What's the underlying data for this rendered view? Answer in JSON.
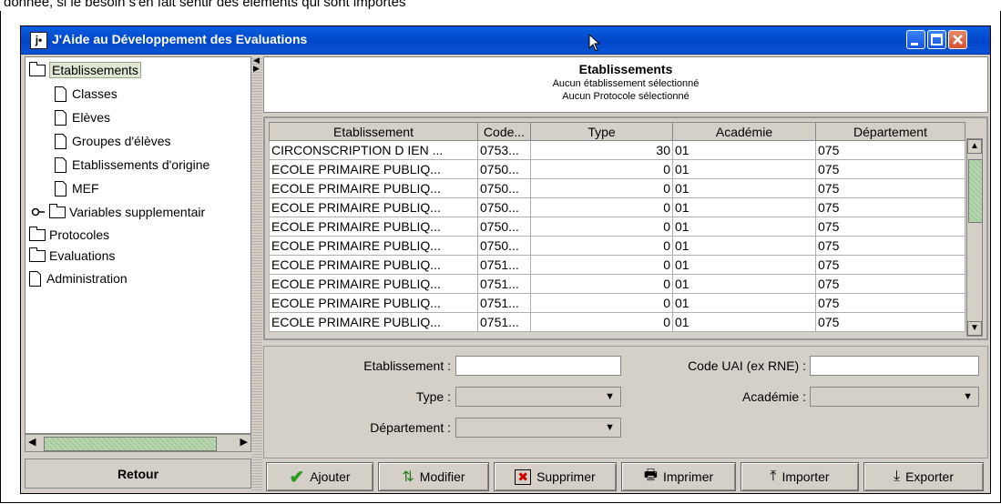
{
  "document": {
    "caption": "donnée, si le besoin s'en fait sentir des éléments qui sont importés"
  },
  "window": {
    "title": "J'Aide au Développement des Evaluations",
    "app_icon": "j•",
    "controls": [
      "minimize-icon",
      "maximize-icon",
      "close-icon"
    ]
  },
  "tree": {
    "nodes": [
      {
        "label": "Etablissements",
        "icon": "folder-icon",
        "level": 0,
        "selected": true
      },
      {
        "label": "Classes",
        "icon": "document-icon",
        "level": 1
      },
      {
        "label": "Elèves",
        "icon": "document-icon",
        "level": 1
      },
      {
        "label": "Groupes d'élèves",
        "icon": "document-icon",
        "level": 1
      },
      {
        "label": "Etablissements d'origine",
        "icon": "document-icon",
        "level": 1
      },
      {
        "label": "MEF",
        "icon": "document-icon",
        "level": 1
      },
      {
        "label": "Variables supplementair",
        "icon": "folder-icon",
        "level": 0,
        "expander": true
      },
      {
        "label": "Protocoles",
        "icon": "folder-icon",
        "level": 0
      },
      {
        "label": "Evaluations",
        "icon": "folder-icon",
        "level": 0
      },
      {
        "label": "Administration",
        "icon": "document-icon",
        "level": 0
      }
    ],
    "back_button": "Retour"
  },
  "header": {
    "title": "Etablissements",
    "line1": "Aucun établissement sélectionné",
    "line2": "Aucun Protocole sélectionné"
  },
  "table": {
    "columns": [
      "Etablissement",
      "Code...",
      "Type",
      "Académie",
      "Département"
    ],
    "rows": [
      [
        "CIRCONSCRIPTION D IEN ...",
        "0753...",
        "30",
        "01",
        "075"
      ],
      [
        "ECOLE PRIMAIRE PUBLIQ...",
        "0750...",
        "0",
        "01",
        "075"
      ],
      [
        "ECOLE PRIMAIRE PUBLIQ...",
        "0750...",
        "0",
        "01",
        "075"
      ],
      [
        "ECOLE PRIMAIRE PUBLIQ...",
        "0750...",
        "0",
        "01",
        "075"
      ],
      [
        "ECOLE PRIMAIRE PUBLIQ...",
        "0750...",
        "0",
        "01",
        "075"
      ],
      [
        "ECOLE PRIMAIRE PUBLIQ...",
        "0750...",
        "0",
        "01",
        "075"
      ],
      [
        "ECOLE PRIMAIRE PUBLIQ...",
        "0751...",
        "0",
        "01",
        "075"
      ],
      [
        "ECOLE PRIMAIRE PUBLIQ...",
        "0751...",
        "0",
        "01",
        "075"
      ],
      [
        "ECOLE PRIMAIRE PUBLIQ...",
        "0751...",
        "0",
        "01",
        "075"
      ],
      [
        "ECOLE PRIMAIRE PUBLIQ...",
        "0751...",
        "0",
        "01",
        "075"
      ]
    ]
  },
  "form": {
    "etablissement_label": "Etablissement :",
    "etablissement_value": "",
    "code_uai_label": "Code UAI (ex RNE) :",
    "code_uai_value": "",
    "type_label": "Type :",
    "type_value": "",
    "academie_label": "Académie :",
    "academie_value": "",
    "departement_label": "Département :",
    "departement_value": ""
  },
  "actions": {
    "add": "Ajouter",
    "edit": "Modifier",
    "delete": "Supprimer",
    "print": "Imprimer",
    "import": "Importer",
    "export": "Exporter"
  },
  "colors": {
    "titlebar": "#0046c8",
    "window_bg": "#d4d0c8",
    "selected_node": "#dfe7d4",
    "add_icon": "#2e9a1e"
  }
}
